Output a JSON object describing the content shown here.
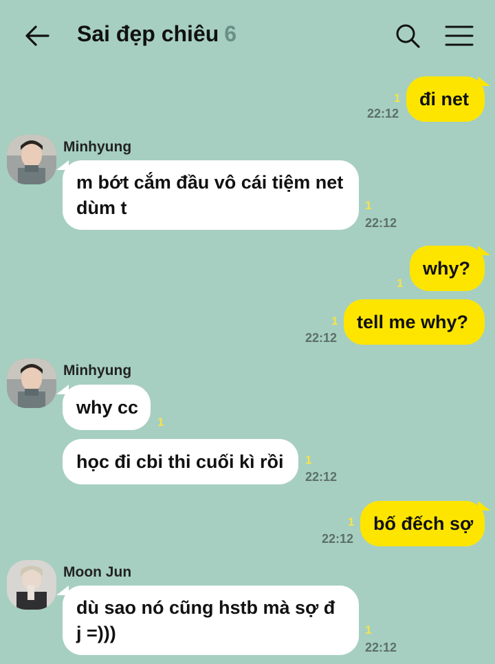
{
  "header": {
    "title": "Sai đẹp chiêu",
    "member_count": "6"
  },
  "colors": {
    "background": "#a6cfc1",
    "my_bubble": "#fee500",
    "their_bubble": "#ffffff",
    "unread": "#f6e34a"
  },
  "messages": [
    {
      "text": "đi net",
      "unread": "1",
      "time": "22:12"
    },
    {
      "sender": "Minhyung",
      "text": "m bớt cắm đầu vô cái tiệm net dùm t",
      "unread": "1",
      "time": "22:12"
    },
    {
      "text": "why?",
      "unread": "1"
    },
    {
      "text": "tell me why?",
      "unread": "1",
      "time": "22:12"
    },
    {
      "sender": "Minhyung",
      "text": "why cc",
      "unread": "1"
    },
    {
      "text": "học đi cbi thi cuối kì rồi",
      "unread": "1",
      "time": "22:12"
    },
    {
      "text": "bố đếch sợ",
      "unread": "1",
      "time": "22:12"
    },
    {
      "sender": "Moon Jun",
      "text": "dù sao nó cũng hstb mà sợ đ j =)))",
      "unread": "1",
      "time": "22:12"
    }
  ]
}
